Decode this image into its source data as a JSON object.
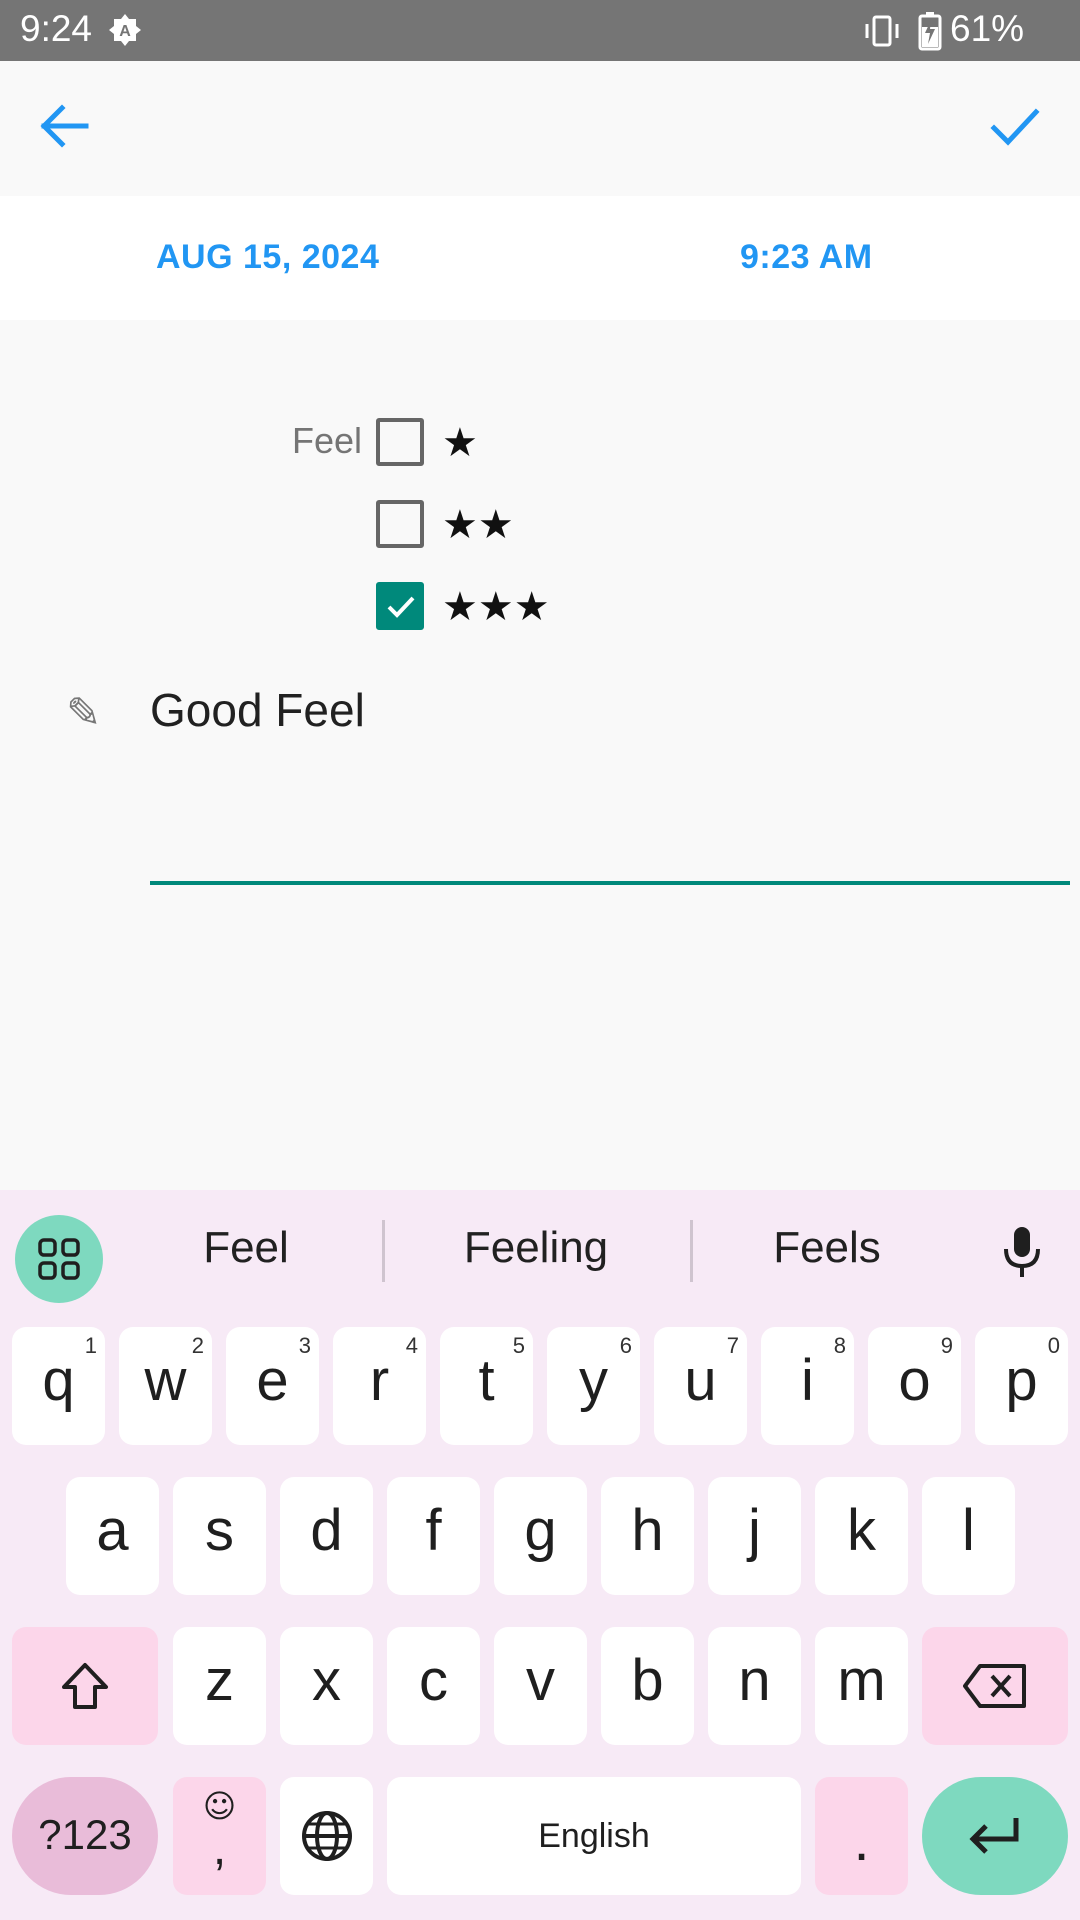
{
  "status_bar": {
    "time": "9:24",
    "battery_percent": "61%"
  },
  "toolbar": {
    "back_icon": "arrow-left-icon",
    "done_icon": "check-icon",
    "accent": "#2196f3"
  },
  "entry": {
    "date": "AUG 15, 2024",
    "time": "9:23 AM",
    "feel_label": "Feel",
    "options": [
      {
        "stars": "★",
        "checked": false
      },
      {
        "stars": "★★",
        "checked": false
      },
      {
        "stars": "★★★",
        "checked": true
      }
    ],
    "note_icon": "✎",
    "note_text": "Good Feel",
    "accent": "#00897b"
  },
  "keyboard": {
    "suggestions": [
      "Feel",
      "Feeling",
      "Feels"
    ],
    "row1": [
      {
        "k": "q",
        "h": "1"
      },
      {
        "k": "w",
        "h": "2"
      },
      {
        "k": "e",
        "h": "3"
      },
      {
        "k": "r",
        "h": "4"
      },
      {
        "k": "t",
        "h": "5"
      },
      {
        "k": "y",
        "h": "6"
      },
      {
        "k": "u",
        "h": "7"
      },
      {
        "k": "i",
        "h": "8"
      },
      {
        "k": "o",
        "h": "9"
      },
      {
        "k": "p",
        "h": "0"
      }
    ],
    "row2": [
      "a",
      "s",
      "d",
      "f",
      "g",
      "h",
      "j",
      "k",
      "l"
    ],
    "row3": [
      "z",
      "x",
      "c",
      "v",
      "b",
      "n",
      "m"
    ],
    "symbols_label": "?123",
    "emoji_label": "☺",
    "comma_label": ",",
    "space_label": "English",
    "period_label": "."
  }
}
